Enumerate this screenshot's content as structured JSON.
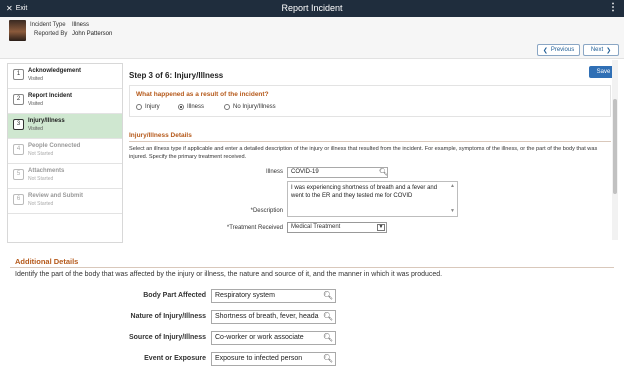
{
  "topbar": {
    "exit_label": "Exit",
    "title": "Report Incident",
    "menu_icon": "kebab-icon"
  },
  "header": {
    "incident_type_label": "Incident Type",
    "incident_type_value": "Illness",
    "reported_by_label": "Reported By",
    "reported_by_value": "John Patterson",
    "previous_label": "Previous",
    "next_label": "Next"
  },
  "steps": [
    {
      "num": "1",
      "label": "Acknowledgement",
      "status": "Visited"
    },
    {
      "num": "2",
      "label": "Report Incident",
      "status": "Visited"
    },
    {
      "num": "3",
      "label": "Injury/Illness",
      "status": "Visited"
    },
    {
      "num": "4",
      "label": "People Connected",
      "status": "Not Started"
    },
    {
      "num": "5",
      "label": "Attachments",
      "status": "Not Started"
    },
    {
      "num": "6",
      "label": "Review and Submit",
      "status": "Not Started"
    }
  ],
  "main": {
    "step_title": "Step 3 of 6: Injury/Illness",
    "save_label": "Save",
    "question": "What happened as a result of the incident?",
    "options": [
      "Injury",
      "Illness",
      "No Injury/Illness"
    ],
    "selected_option": "Illness",
    "details_title": "Injury/Illness Details",
    "details_desc": "Select an illness type if applicable and enter a detailed description of the injury or illness that resulted from the incident. For example, symptoms of the illness, or the part of the body that was injured. Specify the primary treatment received.",
    "illness_label": "Illness",
    "illness_value": "COVID-19",
    "description_label": "*Description",
    "description_value": "I was experiencing shortness of breath and a fever and went to the ER and they tested me for COVID",
    "treatment_label": "*Treatment Received",
    "treatment_value": "Medical Treatment"
  },
  "additional": {
    "title": "Additional Details",
    "desc": "Identify the part of the body that was affected by the injury or illness, the nature and source of it, and the manner in which it was produced.",
    "fields": [
      {
        "label": "Body Part Affected",
        "value": "Respiratory system"
      },
      {
        "label": "Nature of Injury/Illness",
        "value": "Shortness of breath, fever, heada"
      },
      {
        "label": "Source of Injury/Illness",
        "value": "Co-worker or work associate"
      },
      {
        "label": "Event or Exposure",
        "value": "Exposure to infected person"
      }
    ]
  },
  "colors": {
    "accent": "#2f6fb5",
    "section_title": "#b5591a",
    "active_step": "#cfe7d0",
    "topbar": "#1f2d3d"
  }
}
